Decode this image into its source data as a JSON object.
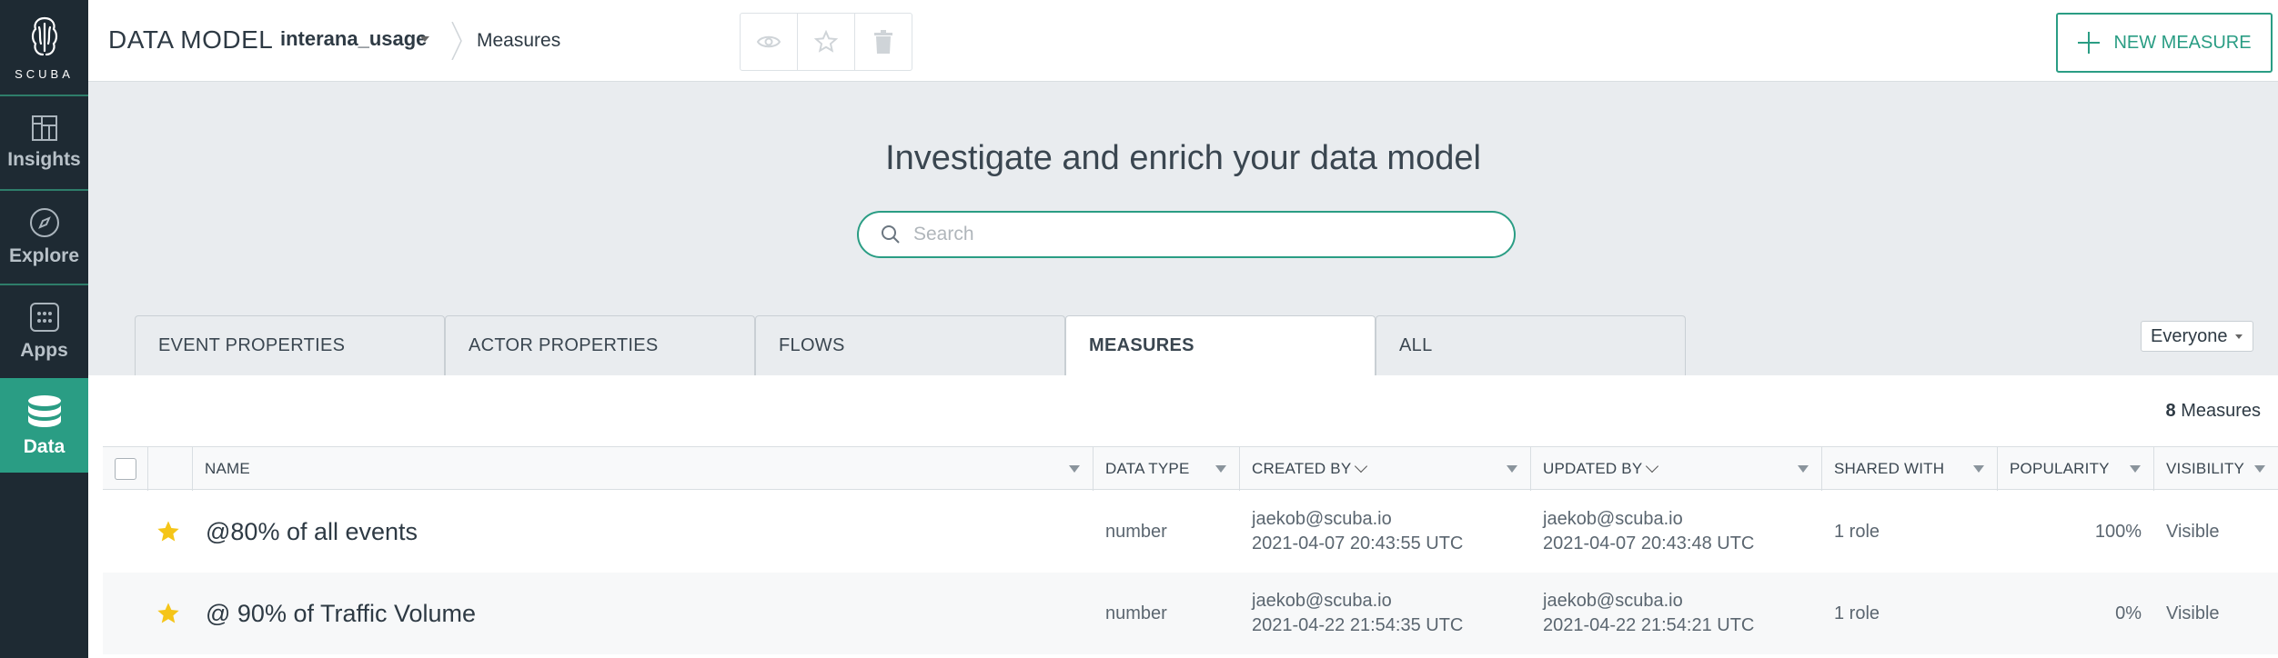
{
  "sidebar": {
    "logo_text": "SCUBA",
    "items": [
      {
        "label": "Insights",
        "icon": "insights-icon"
      },
      {
        "label": "Explore",
        "icon": "compass-icon"
      },
      {
        "label": "Apps",
        "icon": "apps-grid-icon"
      },
      {
        "label": "Data",
        "icon": "database-icon",
        "active": true
      }
    ]
  },
  "header": {
    "title": "DATA MODEL",
    "dataset": "interana_usage",
    "breadcrumb": "Measures",
    "new_button": "NEW MEASURE"
  },
  "hero": {
    "title": "Investigate and enrich your data model",
    "search_placeholder": "Search"
  },
  "tabs": [
    {
      "label": "EVENT PROPERTIES"
    },
    {
      "label": "ACTOR PROPERTIES"
    },
    {
      "label": "FLOWS"
    },
    {
      "label": "MEASURES",
      "active": true
    },
    {
      "label": "ALL"
    }
  ],
  "filter": {
    "selected": "Everyone"
  },
  "count": {
    "number": "8",
    "label": "Measures"
  },
  "table": {
    "columns": [
      "NAME",
      "DATA TYPE",
      "CREATED BY",
      "UPDATED BY",
      "SHARED WITH",
      "POPULARITY",
      "VISIBILITY"
    ],
    "rows": [
      {
        "name": "@80% of all events",
        "data_type": "number",
        "created_by": "jaekob@scuba.io",
        "created_at": "2021-04-07 20:43:55 UTC",
        "updated_by": "jaekob@scuba.io",
        "updated_at": "2021-04-07 20:43:48 UTC",
        "shared_with": "1 role",
        "popularity": "100%",
        "visibility": "Visible"
      },
      {
        "name": "@ 90% of Traffic Volume",
        "data_type": "number",
        "created_by": "jaekob@scuba.io",
        "created_at": "2021-04-22 21:54:35 UTC",
        "updated_by": "jaekob@scuba.io",
        "updated_at": "2021-04-22 21:54:21 UTC",
        "shared_with": "1 role",
        "popularity": "0%",
        "visibility": "Visible"
      }
    ]
  },
  "colors": {
    "accent": "#2a9d84",
    "sidebar": "#1e2a33",
    "star": "#f5c518"
  }
}
